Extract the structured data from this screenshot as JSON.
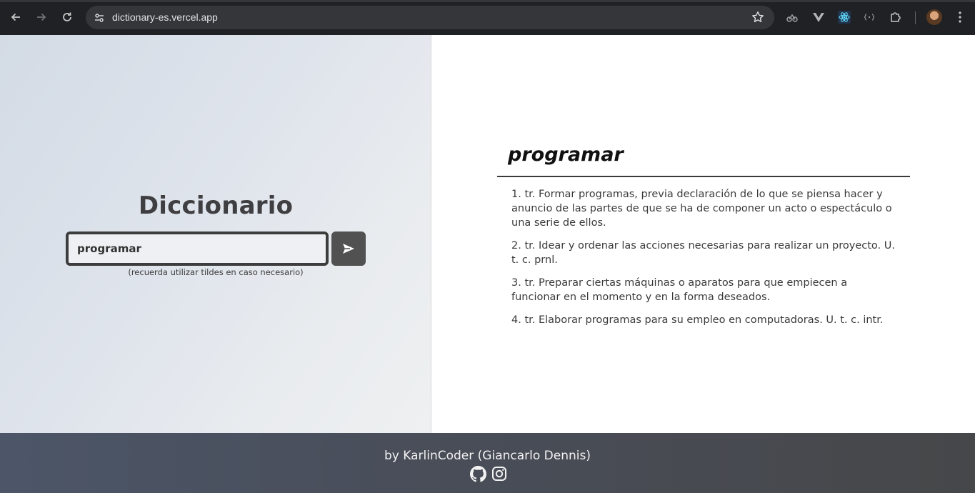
{
  "browser": {
    "url": "dictionary-es.vercel.app",
    "icons": [
      "back-icon",
      "forward-icon",
      "reload-icon",
      "site-settings-icon",
      "bookmark-star-icon",
      "extension-icon",
      "puzzle-extensions-icon",
      "profile-avatar",
      "more-menu-icon"
    ]
  },
  "app": {
    "title": "Diccionario",
    "search": {
      "value": "programar",
      "placeholder": ""
    },
    "hint": "(recuerda utilizar tildes en caso necesario)"
  },
  "result": {
    "word": "programar",
    "definitions": [
      "1. tr. Formar programas, previa declaración de lo que se piensa hacer y anuncio de las partes de que se ha de componer un acto o espectáculo o una serie de ellos.",
      "2. tr. Idear y ordenar las acciones necesarias para realizar un proyecto. U. t. c. prnl.",
      "3. tr. Preparar ciertas máquinas o aparatos para que empiecen a funcionar en el momento y en la forma deseados.",
      "4. tr. Elaborar programas para su empleo en computadoras. U. t. c. intr."
    ]
  },
  "footer": {
    "credit": "by KarlinCoder (Giancarlo Dennis)",
    "icons": [
      "github-icon",
      "instagram-icon"
    ]
  },
  "colors": {
    "chrome_bg": "#202124",
    "omnibox_bg": "#35363a",
    "title_text": "#3f3f41",
    "submit_bg": "#515151",
    "footer_bg": "#494e5a"
  }
}
